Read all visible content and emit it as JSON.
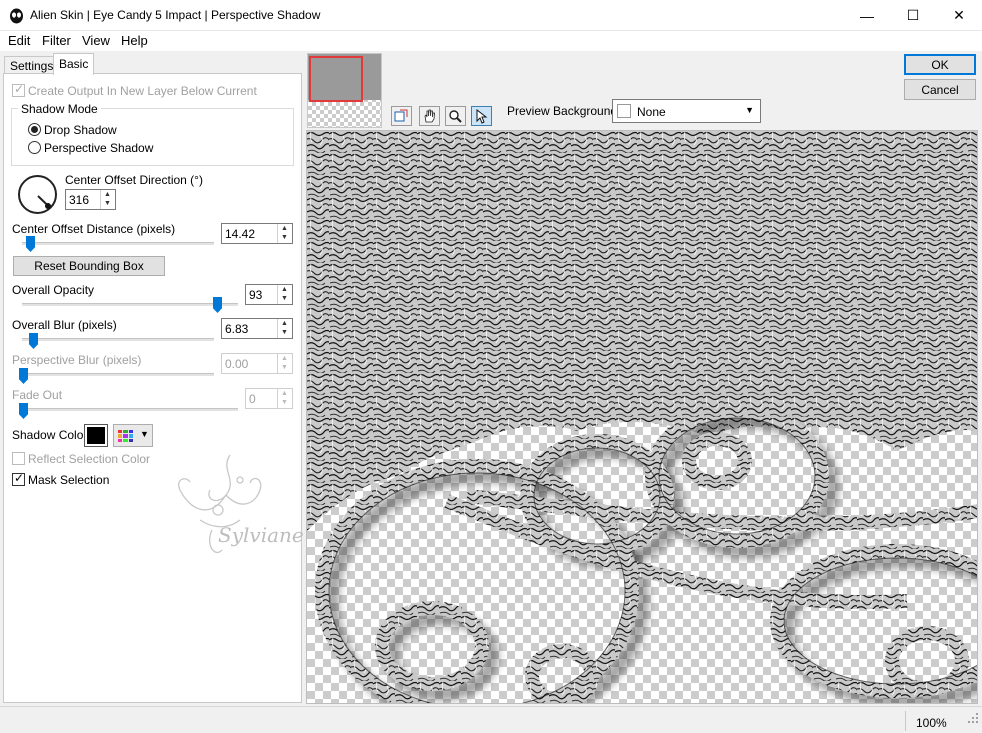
{
  "window": {
    "title": "Alien Skin | Eye Candy 5 Impact | Perspective Shadow",
    "min_glyph": "—",
    "max_glyph": "☐",
    "close_glyph": "✕"
  },
  "menu": [
    "Edit",
    "Filter",
    "View",
    "Help"
  ],
  "tabs": {
    "settings": "Settings",
    "basic": "Basic"
  },
  "basic": {
    "create_output_label": "Create Output In New Layer Below Current",
    "create_output_checked": true,
    "shadow_mode_title": "Shadow Mode",
    "drop_shadow_label": "Drop Shadow",
    "perspective_shadow_label": "Perspective Shadow",
    "selected_mode": "Drop Shadow",
    "center_offset_direction_label": "Center Offset Direction (°)",
    "center_offset_direction_value": "316",
    "center_offset_distance_label": "Center Offset Distance (pixels)",
    "center_offset_distance_value": "14.42",
    "reset_bounding_box_label": "Reset Bounding Box",
    "overall_opacity_label": "Overall Opacity",
    "overall_opacity_value": "93",
    "overall_blur_label": "Overall Blur (pixels)",
    "overall_blur_value": "6.83",
    "perspective_blur_label": "Perspective Blur (pixels)",
    "perspective_blur_value": "0.00",
    "fade_out_label": "Fade Out",
    "fade_out_value": "0",
    "shadow_color_label": "Shadow Color",
    "shadow_color": "#000000",
    "reflect_selection_color_label": "Reflect Selection Color",
    "reflect_selection_color_checked": false,
    "mask_selection_label": "Mask Selection",
    "mask_selection_checked": true
  },
  "watermark_text": "Sylviane",
  "buttons": {
    "ok": "OK",
    "cancel": "Cancel"
  },
  "tools": [
    "bounding-box-icon",
    "hand-icon",
    "zoom-icon",
    "arrow-pointer-icon"
  ],
  "preview_background": {
    "label": "Preview Background:",
    "value": "None"
  },
  "status": {
    "zoom": "100%"
  },
  "colors": {
    "accent": "#0078d7",
    "thumb_nav_border": "#e03a3a"
  }
}
